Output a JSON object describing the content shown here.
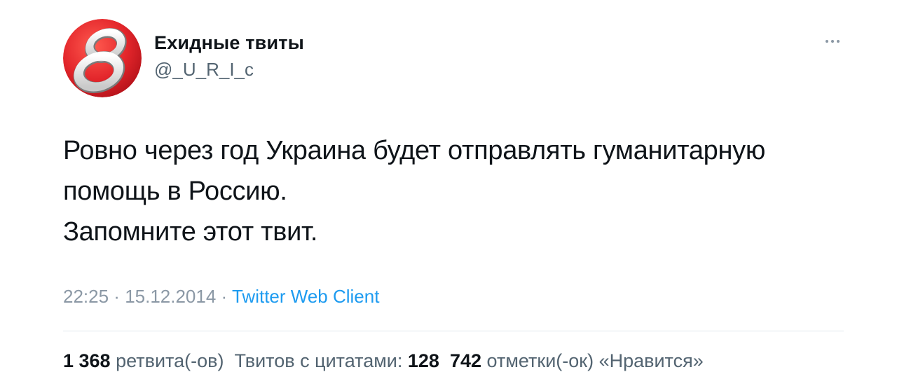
{
  "author": {
    "display_name": "Ехидные твиты",
    "handle": "@_U_R_I_c",
    "avatar_glyph": "8",
    "avatar_color": "#e3262b"
  },
  "tweet": {
    "lines": [
      "Ровно через год Украина будет отправлять гуманитарную",
      "помощь в Россию.",
      "Запомните этот твит."
    ],
    "time": "22:25",
    "separator": " · ",
    "date": "15.12.2014",
    "source": "Twitter Web Client"
  },
  "stats": {
    "retweets_count": "1 368",
    "retweets_label": "ретвита(-ов)",
    "quotes_label": "Твитов с цитатами:",
    "quotes_count": "128",
    "likes_count": "742",
    "likes_label": "отметки(-ок) «Нравится»"
  },
  "icons": {
    "more": "more-dots-icon"
  },
  "colors": {
    "link": "#1d9bf0",
    "text": "#0f1419",
    "muted": "#8b98a5"
  }
}
